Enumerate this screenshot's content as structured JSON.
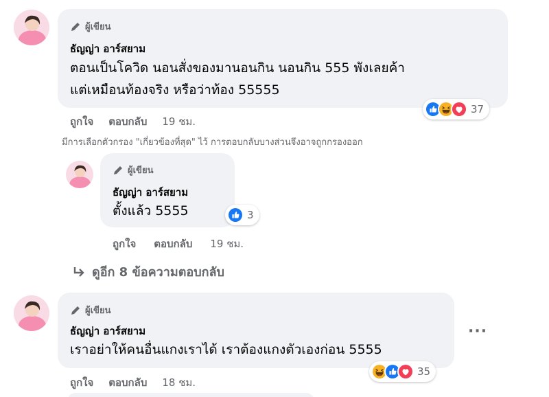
{
  "comments": [
    {
      "badge": "ผู้เขียน",
      "name": "ธัญญ่า อาร์สยาม",
      "line1": "ตอนเป็นโควิด นอนสั่งของมานอนกิน นอนกิน 555 พังเลยค้า",
      "line2": "แต่เหมือนท้องจริง หรือว่าท้อง 55555",
      "reactions": [
        "like",
        "haha",
        "love"
      ],
      "reaction_count": "37",
      "like_label": "ถูกใจ",
      "reply_label": "ตอบกลับ",
      "time": "19 ชม."
    },
    {
      "badge": "ผู้เขียน",
      "name": "ธัญญ่า อาร์สยาม",
      "line1": "ตั้งแล้ว 5555",
      "reactions": [
        "like"
      ],
      "reaction_count": "3",
      "like_label": "ถูกใจ",
      "reply_label": "ตอบกลับ",
      "time": "19 ชม."
    },
    {
      "badge": "ผู้เขียน",
      "name": "ธัญญ่า อาร์สยาม",
      "line1": "เราอย่าให้คนอื่นแกงเราได้ เราต้องแกงตัวเองก่อน 5555",
      "reactions": [
        "haha",
        "like",
        "love"
      ],
      "reaction_count": "35",
      "like_label": "ถูกใจ",
      "reply_label": "ตอบกลับ",
      "time": "18 ชม."
    }
  ],
  "filter_note": "มีการเลือกตัวกรอง \"เกี่ยวข้องที่สุด\" ไว้ การตอบกลับบางส่วนจึงอาจถูกกรองออก",
  "more_replies": "ดูอีก 8 ข้อความตอบกลับ",
  "more_options": "···",
  "colors": {
    "like": "#1877f2",
    "love": "#f33e58",
    "haha": "#f7b125",
    "secondary_text": "#65676b",
    "bubble": "#f0f2f5"
  }
}
